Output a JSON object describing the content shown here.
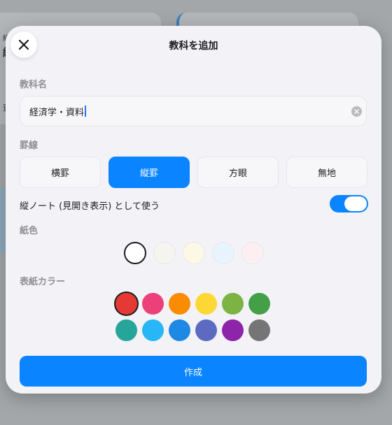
{
  "background": {
    "card_text_1": "経",
    "card_text_2": "経",
    "card_text_3": "更"
  },
  "modal": {
    "title": "教科を追加",
    "close_icon": "close-icon"
  },
  "subject_name": {
    "label": "教科名",
    "value": "経済学・資料",
    "clear_icon": "clear-circle-icon"
  },
  "ruling": {
    "label": "罫線",
    "options": [
      {
        "label": "横罫",
        "selected": false
      },
      {
        "label": "縦罫",
        "selected": true
      },
      {
        "label": "方眼",
        "selected": false
      },
      {
        "label": "無地",
        "selected": false
      }
    ]
  },
  "vertical_toggle": {
    "label": "縦ノート (見開き表示) として使う",
    "on": true
  },
  "paper_color": {
    "label": "紙色",
    "colors": [
      "#ffffff",
      "#f6f4ee",
      "#fdf8e5",
      "#e8f4fd",
      "#fdeef1"
    ],
    "selected_index": 0
  },
  "cover_color": {
    "label": "表紙カラー",
    "colors": [
      "#e53935",
      "#ec407a",
      "#fb8c00",
      "#fdd835",
      "#7cb342",
      "#43a047",
      "#26a69a",
      "#29b6f6",
      "#1e88e5",
      "#5c6bc0",
      "#8e24aa",
      "#757575"
    ],
    "selected_index": 0
  },
  "create_button": {
    "label": "作成"
  },
  "colors": {
    "accent": "#0a84ff"
  }
}
